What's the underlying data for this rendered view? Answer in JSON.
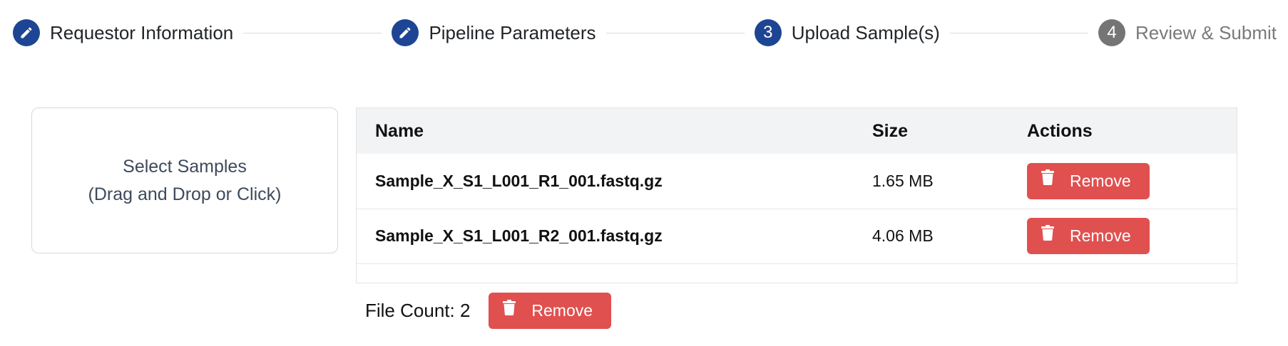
{
  "stepper": {
    "steps": [
      {
        "marker": "",
        "icon": "pencil-icon",
        "label": "Requestor Information",
        "state": "completed"
      },
      {
        "marker": "",
        "icon": "pencil-icon",
        "label": "Pipeline Parameters",
        "state": "completed"
      },
      {
        "marker": "3",
        "label": "Upload Sample(s)",
        "state": "active"
      },
      {
        "marker": "4",
        "label": "Review & Submit",
        "state": "inactive"
      }
    ]
  },
  "dropzone": {
    "line1": "Select Samples",
    "line2": "(Drag and Drop or Click)"
  },
  "table": {
    "headers": {
      "name": "Name",
      "size": "Size",
      "actions": "Actions"
    },
    "rows": [
      {
        "name": "Sample_X_S1_L001_R1_001.fastq.gz",
        "size": "1.65 MB",
        "action": "Remove"
      },
      {
        "name": "Sample_X_S1_L001_R2_001.fastq.gz",
        "size": "4.06 MB",
        "action": "Remove"
      }
    ]
  },
  "footer": {
    "file_count": "File Count: 2",
    "remove_all_label": "Remove"
  },
  "colors": {
    "primary": "#1e4593",
    "inactive_step": "#757575",
    "danger": "#e0504f",
    "table_header_bg": "#f2f3f5"
  }
}
